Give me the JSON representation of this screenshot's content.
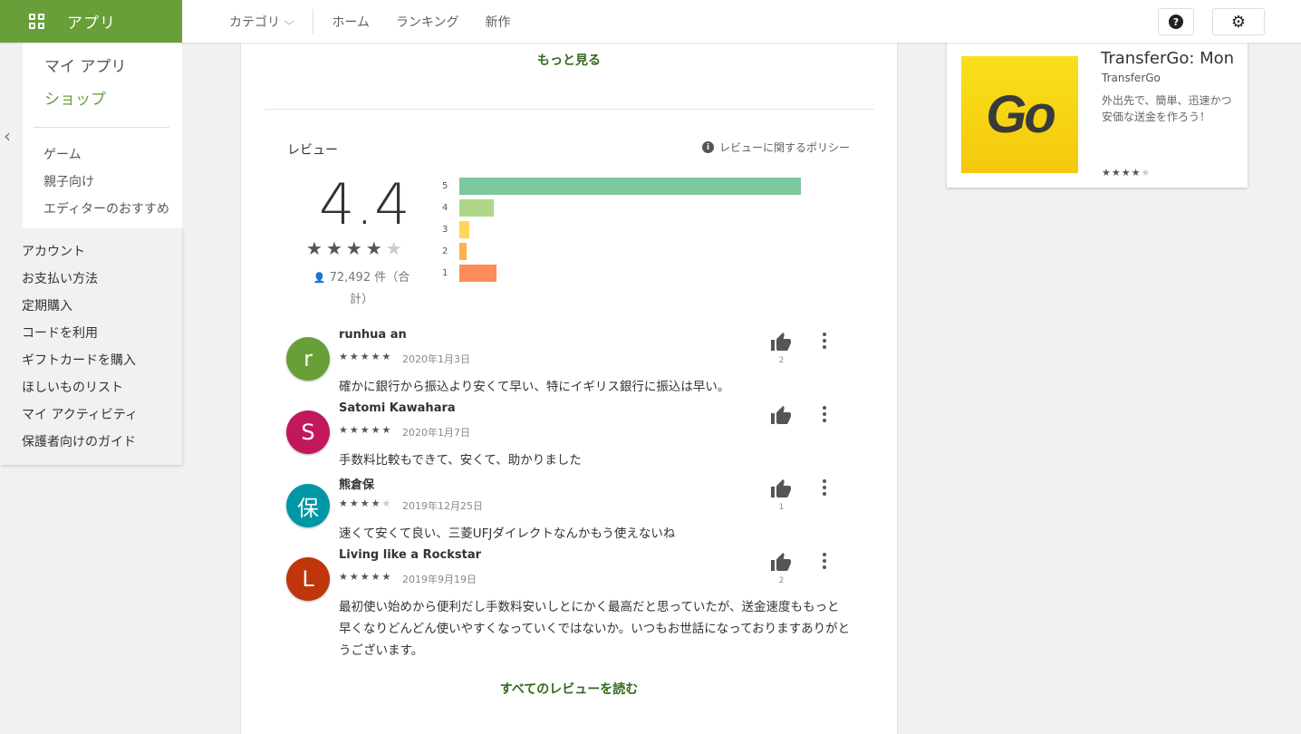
{
  "header": {
    "brand_label": "アプリ",
    "category_label": "カテゴリ",
    "nav": [
      "ホーム",
      "ランキング",
      "新作"
    ]
  },
  "sidebar": {
    "my_apps": "マイ アプリ",
    "shop": "ショップ",
    "sub_items": [
      "ゲーム",
      "親子向け",
      "エディターのおすすめ"
    ],
    "account_links": [
      "アカウント",
      "お支払い方法",
      "定期購入",
      "コードを利用",
      "ギフトカードを購入",
      "ほしいものリスト",
      "マイ アクティビティ",
      "保護者向けのガイド"
    ]
  },
  "main": {
    "more_link": "もっと見る",
    "reviews_title": "レビュー",
    "policy_link": "レビューに関するポリシー",
    "rating": {
      "score": "4.4",
      "stars": 4.5,
      "count_text": "72,492 件（合計）",
      "histogram": [
        {
          "label": "5",
          "value": 1.0,
          "color": "#7bc79e"
        },
        {
          "label": "4",
          "value": 0.1,
          "color": "#aed887"
        },
        {
          "label": "3",
          "value": 0.03,
          "color": "#ffd655"
        },
        {
          "label": "2",
          "value": 0.02,
          "color": "#ffb34a"
        },
        {
          "label": "1",
          "value": 0.11,
          "color": "#ff8b5a"
        }
      ]
    },
    "reviews": [
      {
        "initial": "r",
        "avatar_color": "#689f38",
        "name": "runhua an",
        "stars": 5,
        "date": "2020年1月3日",
        "text": "確かに銀行から振込より安くて早い、特にイギリス銀行に振込は早い。",
        "helpful": "2"
      },
      {
        "initial": "S",
        "avatar_color": "#c2185b",
        "name": "Satomi Kawahara",
        "stars": 5,
        "date": "2020年1月7日",
        "text": "手数料比較もできて、安くて、助かりました",
        "helpful": ""
      },
      {
        "initial": "保",
        "avatar_color": "#0097a7",
        "name": "熊倉保",
        "stars": 4,
        "date": "2019年12月25日",
        "text": "速くて安くて良い、三菱UFJダイレクトなんかもう使えないね",
        "helpful": "1"
      },
      {
        "initial": "L",
        "avatar_color": "#bf360c",
        "name": "Living like a Rockstar",
        "stars": 5,
        "date": "2019年9月19日",
        "text": "最初使い始めから便利だし手数料安いしとにかく最高だと思っていたが、送金速度ももっと早くなりどんどん使いやすくなっていくではないか。いつもお世話になっておりますありがとうございます。",
        "helpful": "2"
      }
    ],
    "all_reviews_link": "すべてのレビューを読む"
  },
  "similar_app": {
    "icon_text": "Go",
    "title": "TransferGo: Money Transfer",
    "developer": "TransferGo",
    "description": "外出先で、簡単、迅速かつ安価な送金を作ろう！",
    "stars": 4
  }
}
